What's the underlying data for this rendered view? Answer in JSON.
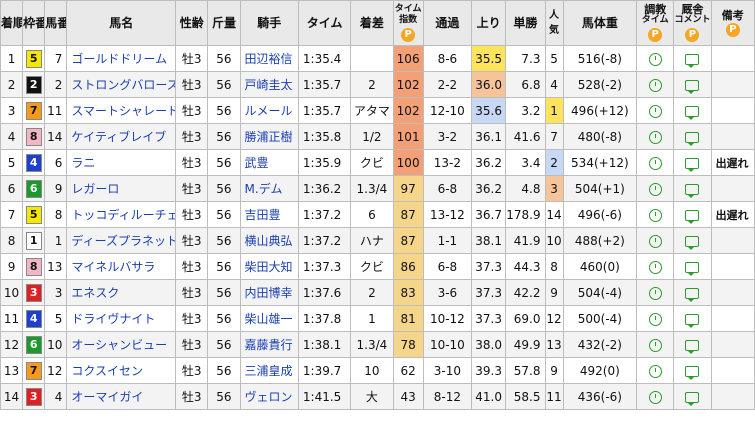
{
  "headers": {
    "rank": "着順",
    "waku": "枠番",
    "uma": "馬番",
    "horse": "馬名",
    "sexage": "性齢",
    "weight": "斤量",
    "jockey": "騎手",
    "time": "タイム",
    "margin": "着差",
    "index_top": "タイム",
    "index_bottom": "指数",
    "passing": "通過",
    "last3f": "上り",
    "odds": "単勝",
    "popularity": "人気",
    "bodyweight": "馬体重",
    "training_top": "調教",
    "training_bottom": "タイム",
    "comment_top": "厩舎",
    "comment_bottom": "コメント",
    "remarks": "備考",
    "p_badge": "P"
  },
  "rows": [
    {
      "rank": "1",
      "waku": "5",
      "uma": "7",
      "horse": "ゴールドドリーム",
      "sexage": "牡3",
      "weight": "56",
      "jockey": "田辺裕信",
      "time": "1:35.4",
      "margin": "",
      "index": "106",
      "passing": "8-6",
      "last3f": "35.5",
      "odds": "7.3",
      "popularity": "5",
      "bodyweight": "516(-8)",
      "remarks": ""
    },
    {
      "rank": "2",
      "waku": "2",
      "uma": "2",
      "horse": "ストロングバローズ",
      "sexage": "牡3",
      "weight": "56",
      "jockey": "戸崎圭太",
      "time": "1:35.7",
      "margin": "2",
      "index": "102",
      "passing": "2-2",
      "last3f": "36.0",
      "odds": "6.8",
      "popularity": "4",
      "bodyweight": "528(-2)",
      "remarks": ""
    },
    {
      "rank": "3",
      "waku": "7",
      "uma": "11",
      "horse": "スマートシャレード",
      "sexage": "牡3",
      "weight": "56",
      "jockey": "ルメール",
      "time": "1:35.7",
      "margin": "アタマ",
      "index": "102",
      "passing": "12-10",
      "last3f": "35.6",
      "odds": "3.2",
      "popularity": "1",
      "bodyweight": "496(+12)",
      "remarks": ""
    },
    {
      "rank": "4",
      "waku": "8",
      "uma": "14",
      "horse": "ケイティブレイブ",
      "sexage": "牡3",
      "weight": "56",
      "jockey": "勝浦正樹",
      "time": "1:35.8",
      "margin": "1/2",
      "index": "101",
      "passing": "3-2",
      "last3f": "36.1",
      "odds": "41.6",
      "popularity": "7",
      "bodyweight": "480(-8)",
      "remarks": ""
    },
    {
      "rank": "5",
      "waku": "4",
      "uma": "6",
      "horse": "ラニ",
      "sexage": "牡3",
      "weight": "56",
      "jockey": "武豊",
      "time": "1:35.9",
      "margin": "クビ",
      "index": "100",
      "passing": "13-2",
      "last3f": "36.2",
      "odds": "3.4",
      "popularity": "2",
      "bodyweight": "534(+12)",
      "remarks": "出遅れ"
    },
    {
      "rank": "6",
      "waku": "6",
      "uma": "9",
      "horse": "レガーロ",
      "sexage": "牡3",
      "weight": "56",
      "jockey": "M.デム",
      "time": "1:36.2",
      "margin": "1.3/4",
      "index": "97",
      "passing": "6-8",
      "last3f": "36.2",
      "odds": "4.8",
      "popularity": "3",
      "bodyweight": "504(+1)",
      "remarks": ""
    },
    {
      "rank": "7",
      "waku": "5",
      "uma": "8",
      "horse": "トッコディルーチェ",
      "sexage": "牡3",
      "weight": "56",
      "jockey": "吉田豊",
      "time": "1:37.2",
      "margin": "6",
      "index": "87",
      "passing": "13-12",
      "last3f": "36.7",
      "odds": "178.9",
      "popularity": "14",
      "bodyweight": "496(-6)",
      "remarks": "出遅れ"
    },
    {
      "rank": "8",
      "waku": "1",
      "uma": "1",
      "horse": "ディーズプラネット",
      "sexage": "牡3",
      "weight": "56",
      "jockey": "横山典弘",
      "time": "1:37.2",
      "margin": "ハナ",
      "index": "87",
      "passing": "1-1",
      "last3f": "38.1",
      "odds": "41.9",
      "popularity": "10",
      "bodyweight": "488(+2)",
      "remarks": ""
    },
    {
      "rank": "9",
      "waku": "8",
      "uma": "13",
      "horse": "マイネルバサラ",
      "sexage": "牡3",
      "weight": "56",
      "jockey": "柴田大知",
      "time": "1:37.3",
      "margin": "クビ",
      "index": "86",
      "passing": "6-8",
      "last3f": "37.3",
      "odds": "44.3",
      "popularity": "8",
      "bodyweight": "460(0)",
      "remarks": ""
    },
    {
      "rank": "10",
      "waku": "3",
      "uma": "3",
      "horse": "エネスク",
      "sexage": "牡3",
      "weight": "56",
      "jockey": "内田博幸",
      "time": "1:37.6",
      "margin": "2",
      "index": "83",
      "passing": "3-6",
      "last3f": "37.3",
      "odds": "42.2",
      "popularity": "9",
      "bodyweight": "504(-4)",
      "remarks": ""
    },
    {
      "rank": "11",
      "waku": "4",
      "uma": "5",
      "horse": "ドライヴナイト",
      "sexage": "牡3",
      "weight": "56",
      "jockey": "柴山雄一",
      "time": "1:37.8",
      "margin": "1",
      "index": "81",
      "passing": "10-12",
      "last3f": "37.3",
      "odds": "69.0",
      "popularity": "12",
      "bodyweight": "500(-4)",
      "remarks": ""
    },
    {
      "rank": "12",
      "waku": "6",
      "uma": "10",
      "horse": "オーシャンビュー",
      "sexage": "牡3",
      "weight": "56",
      "jockey": "嘉藤貴行",
      "time": "1:38.1",
      "margin": "1.3/4",
      "index": "78",
      "passing": "10-10",
      "last3f": "38.0",
      "odds": "49.9",
      "popularity": "13",
      "bodyweight": "432(-2)",
      "remarks": ""
    },
    {
      "rank": "13",
      "waku": "7",
      "uma": "12",
      "horse": "コクスイセン",
      "sexage": "牡3",
      "weight": "56",
      "jockey": "三浦皇成",
      "time": "1:39.7",
      "margin": "10",
      "index": "62",
      "passing": "3-10",
      "last3f": "39.3",
      "odds": "57.8",
      "popularity": "9",
      "bodyweight": "492(0)",
      "remarks": ""
    },
    {
      "rank": "14",
      "waku": "3",
      "uma": "4",
      "horse": "オーマイガイ",
      "sexage": "牡3",
      "weight": "56",
      "jockey": "ヴェロン",
      "time": "1:41.5",
      "margin": "大",
      "index": "43",
      "passing": "8-12",
      "last3f": "41.0",
      "odds": "58.5",
      "popularity": "11",
      "bodyweight": "436(-6)",
      "remarks": ""
    }
  ],
  "colors": {
    "waku": {
      "1": "#ffffff",
      "2": "#111111",
      "3": "#e02020",
      "4": "#1f3fd1",
      "5": "#f7e600",
      "6": "#1a9a2a",
      "7": "#f59a1a",
      "8": "#f3b6c6"
    },
    "waku_text": {
      "1": "#111111",
      "2": "#ffffff",
      "3": "#ffffff",
      "4": "#ffffff",
      "5": "#111111",
      "6": "#ffffff",
      "7": "#111111",
      "8": "#111111"
    },
    "index_high": "#f4a076",
    "index_mid": "#f5d58a",
    "last3f_fast": "#ffe35a",
    "last3f_second": "#f7c49a",
    "last3f_third": "#c7d8f4",
    "pop1": "#ffe35a",
    "pop2": "#c7d8f4",
    "pop3": "#f7c49a"
  }
}
